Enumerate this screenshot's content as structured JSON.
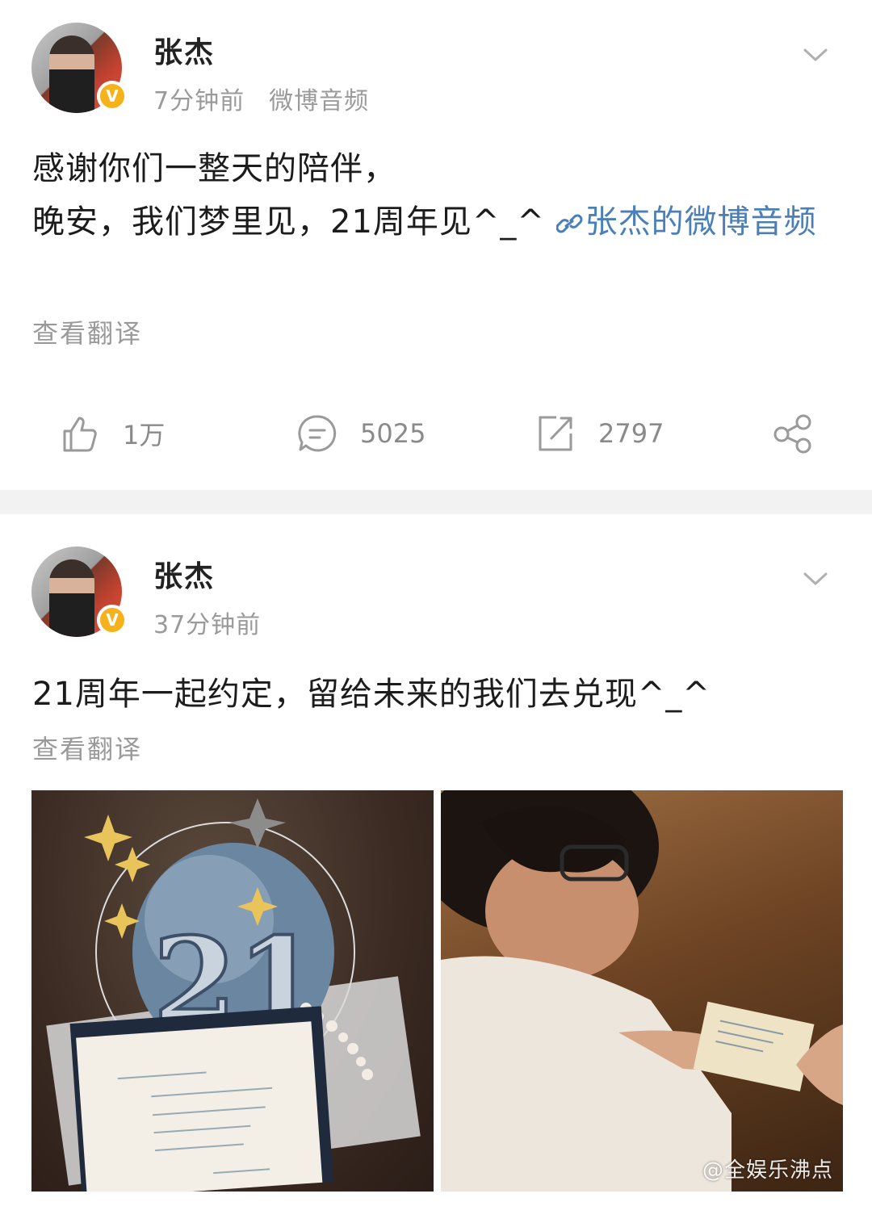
{
  "posts": [
    {
      "username": "张杰",
      "badge": "V",
      "time": "7分钟前",
      "source": "微博音频",
      "content_line1": "感谢你们一整天的陪伴，",
      "content_line2": "晚安，我们梦里见，21周年见^_^",
      "link_text": "张杰的微博音频",
      "translate": "查看翻译",
      "actions": {
        "likes": "1万",
        "comments": "5025",
        "reposts": "2797"
      }
    },
    {
      "username": "张杰",
      "badge": "V",
      "time": "37分钟前",
      "content": "21周年一起约定，留给未来的我们去兑现^_^",
      "translate": "查看翻译",
      "cake_number": "21"
    }
  ],
  "watermark": "@全娱乐沸点",
  "colors": {
    "link": "#4a7fb8",
    "meta": "#9a9a9a",
    "badge": "#f5b21a",
    "divider": "#f2f2f2"
  },
  "icons": [
    "avatar",
    "verified-badge-icon",
    "chevron-down-icon",
    "link-chain-icon",
    "like-icon",
    "comment-icon",
    "repost-icon",
    "share-icon"
  ]
}
